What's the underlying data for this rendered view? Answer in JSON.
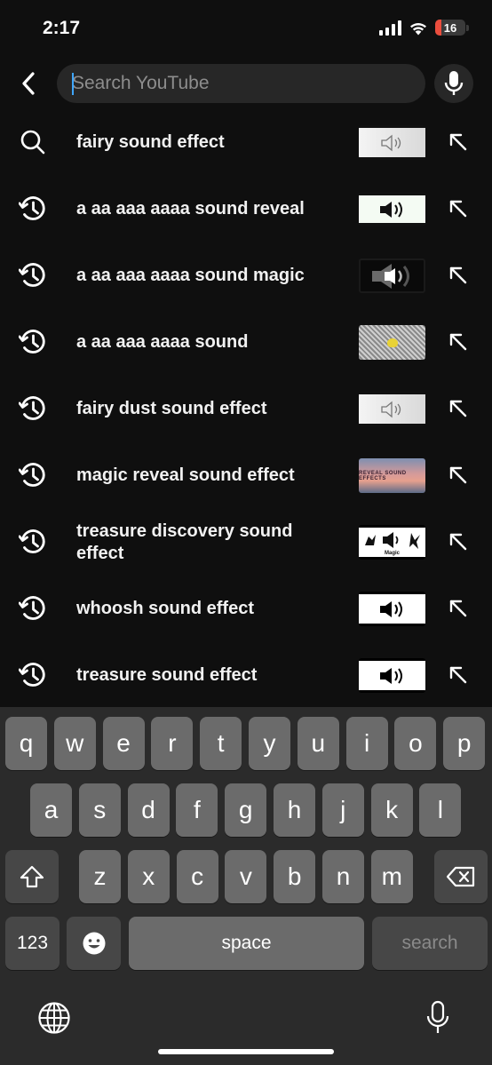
{
  "status_bar": {
    "time": "2:17",
    "battery_level": "16",
    "battery_color": "#eb4d3d"
  },
  "header": {
    "back_icon": "chevron-left-icon",
    "search_placeholder": "Search YouTube",
    "search_value": "",
    "mic_icon": "microphone-icon"
  },
  "suggestions": [
    {
      "type": "search",
      "icon": "search-icon",
      "text": "fairy sound effect",
      "thumb": "light"
    },
    {
      "type": "history",
      "icon": "history-icon",
      "text": "a aa aaa aaaa sound reveal",
      "thumb": "paleGreen"
    },
    {
      "type": "history",
      "icon": "history-icon",
      "text": "a aa aaa aaaa sound magic",
      "thumb": "dark"
    },
    {
      "type": "history",
      "icon": "history-icon",
      "text": "a aa aaa aaaa sound",
      "thumb": "grain"
    },
    {
      "type": "history",
      "icon": "history-icon",
      "text": "fairy dust sound effect",
      "thumb": "light"
    },
    {
      "type": "history",
      "icon": "history-icon",
      "text": "magic reveal sound effect",
      "thumb": "sunset",
      "thumb_text": "REVEAL SOUND EFFECTS"
    },
    {
      "type": "history",
      "icon": "history-icon",
      "text": "treasure discovery sound effect",
      "thumb": "white-magic",
      "thumb_text": "Magic"
    },
    {
      "type": "history",
      "icon": "history-icon",
      "text": "whoosh sound effect",
      "thumb": "white"
    },
    {
      "type": "history",
      "icon": "history-icon",
      "text": "treasure sound effect",
      "thumb": "white"
    }
  ],
  "keyboard": {
    "row1": [
      "q",
      "w",
      "e",
      "r",
      "t",
      "y",
      "u",
      "i",
      "o",
      "p"
    ],
    "row2": [
      "a",
      "s",
      "d",
      "f",
      "g",
      "h",
      "j",
      "k",
      "l"
    ],
    "row3": [
      "z",
      "x",
      "c",
      "v",
      "b",
      "n",
      "m"
    ],
    "numbers_key": "123",
    "space_key": "space",
    "search_key": "search",
    "shift_icon": "shift-icon",
    "backspace_icon": "backspace-icon",
    "emoji_icon": "emoji-icon",
    "globe_icon": "globe-icon",
    "dictation_icon": "microphone-icon"
  }
}
